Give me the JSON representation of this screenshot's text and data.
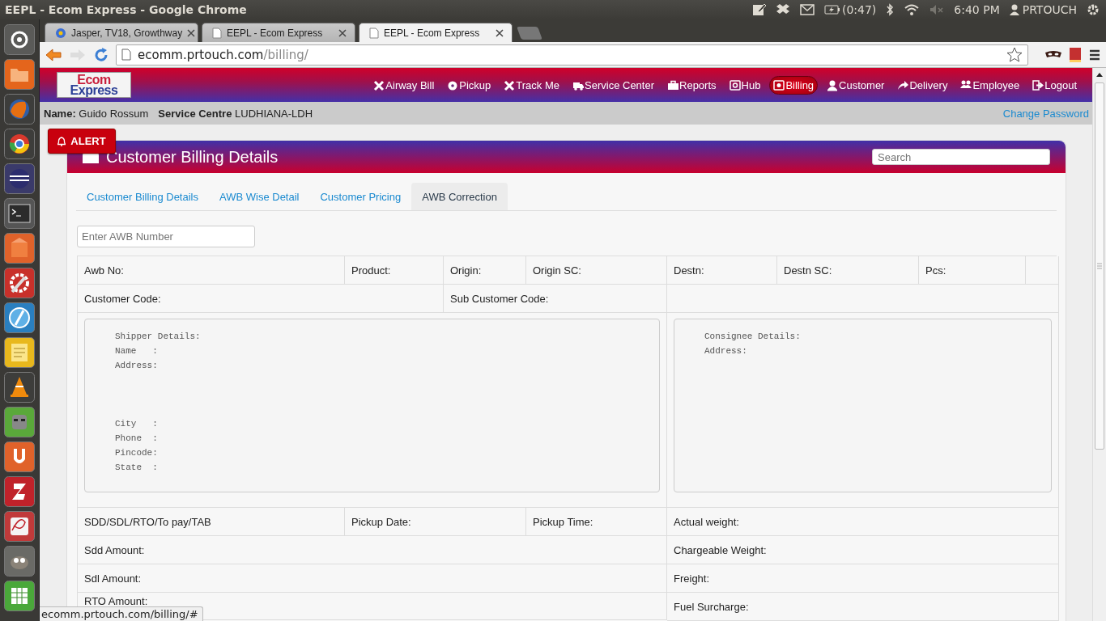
{
  "os_bar": {
    "title": "EEPL - Ecom Express - Google Chrome",
    "battery": "(0:47)",
    "clock": "6:40 PM",
    "user": "PRTOUCH"
  },
  "browser": {
    "tabs": [
      {
        "label": "Jasper, TV18, Growthway",
        "selected": false
      },
      {
        "label": "EEPL - Ecom Express",
        "selected": false
      },
      {
        "label": "EEPL - Ecom Express",
        "selected": true
      }
    ],
    "url": {
      "host": "ecomm.prtouch.com",
      "path": "/billing/"
    },
    "status_url": "ecomm.prtouch.com/billing/#"
  },
  "header": {
    "logo_top": "Ecom",
    "logo_bottom": "Express",
    "nav": [
      {
        "label": "Airway Bill",
        "selected": false
      },
      {
        "label": "Pickup",
        "selected": false
      },
      {
        "label": "Track Me",
        "selected": false
      },
      {
        "label": "Service Center",
        "selected": false
      },
      {
        "label": "Reports",
        "selected": false
      },
      {
        "label": "Hub",
        "selected": false
      },
      {
        "label": "Billing",
        "selected": true
      },
      {
        "label": "Customer",
        "selected": false
      },
      {
        "label": "Delivery",
        "selected": false
      },
      {
        "label": "Employee",
        "selected": false
      },
      {
        "label": "Logout",
        "selected": false
      }
    ]
  },
  "user_bar": {
    "name": "**Name:** Guido Rossum",
    "centre": "**Service Centre** LUDHIANA-LDH",
    "change_password": "Change Password"
  },
  "alert": {
    "label": "ALERT"
  },
  "panel": {
    "title": "Customer Billing Details",
    "search": {
      "placeholder": "Search"
    },
    "tabs": [
      {
        "label": "Customer Billing Details",
        "selected": false
      },
      {
        "label": "AWB Wise Detail",
        "selected": false
      },
      {
        "label": "Customer Pricing",
        "selected": false
      },
      {
        "label": "AWB Correction",
        "selected": true
      }
    ],
    "awb_field": {
      "placeholder": "Enter AWB Number"
    },
    "summary_row": [
      "Awb No:",
      "Product:",
      "Origin:",
      "Origin SC:",
      "Destn:",
      "Destn SC:",
      "Pcs:"
    ],
    "codes_row": [
      "Customer Code:",
      "Sub Customer Code:"
    ],
    "shipper": {
      "title": "Shipper Details:",
      "fields": [
        "Name   :",
        "Address:"
      ],
      "contact_fields": [
        "City   :",
        "Phone  :",
        "Pincode:",
        "State  :"
      ]
    },
    "consignee": {
      "title": "Consignee Details:",
      "fields": [
        "Address:"
      ]
    },
    "shipment_row": [
      "SDD/SDL/RTO/To pay/TAB",
      "Pickup Date:",
      "Pickup Time:",
      "Actual weight:"
    ],
    "amount_rows": [
      {
        "left": "Sdd Amount:",
        "right": "Chargeable Weight:"
      },
      {
        "left": "Sdl Amount:",
        "right": "Freight:"
      },
      {
        "left": "RTO Amount:",
        "right": "Fuel Surcharge:"
      }
    ]
  }
}
